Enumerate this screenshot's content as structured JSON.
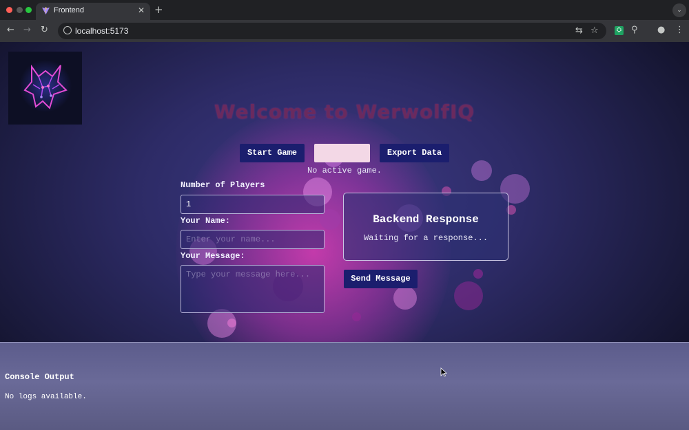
{
  "browser": {
    "tab_title": "Frontend",
    "close_glyph": "✕",
    "new_tab_glyph": "+",
    "tab_menu_glyph": "⌄",
    "url": "localhost:5173",
    "icons": [
      "back-icon",
      "forward-icon",
      "reload-icon",
      "info-icon",
      "translate-icon",
      "star-icon",
      "extension-icon",
      "puzzle-icon",
      "profile-icon",
      "menu-icon"
    ],
    "glyphs": {
      "back": "←",
      "forward": "→",
      "reload": "↻",
      "translate": "⇆",
      "star": "☆",
      "extension": "⛭",
      "puzzle": "⚲",
      "profile": "●",
      "menu": "⋮"
    }
  },
  "page": {
    "welcome": "Welcome to WerwolfIQ",
    "buttons": {
      "start_game": "Start Game",
      "middle": "",
      "export_data": "Export Data",
      "send_message": "Send Message"
    },
    "status": "No active game.",
    "form": {
      "players_label": "Number of Players",
      "players_value": "1",
      "name_label": "Your Name:",
      "name_placeholder": "Enter your name...",
      "message_label": "Your Message:",
      "message_placeholder": "Type your message here..."
    },
    "response": {
      "title": "Backend Response",
      "text": "Waiting for a response..."
    },
    "console": {
      "title": "Console Output",
      "text": "No logs available."
    }
  },
  "colors": {
    "accent": "#1b1e6e",
    "glow": "#dc3cb4",
    "welcome_text": "#6a2a5e",
    "chrome_dark": "#202124",
    "chrome_light": "#35363a"
  }
}
